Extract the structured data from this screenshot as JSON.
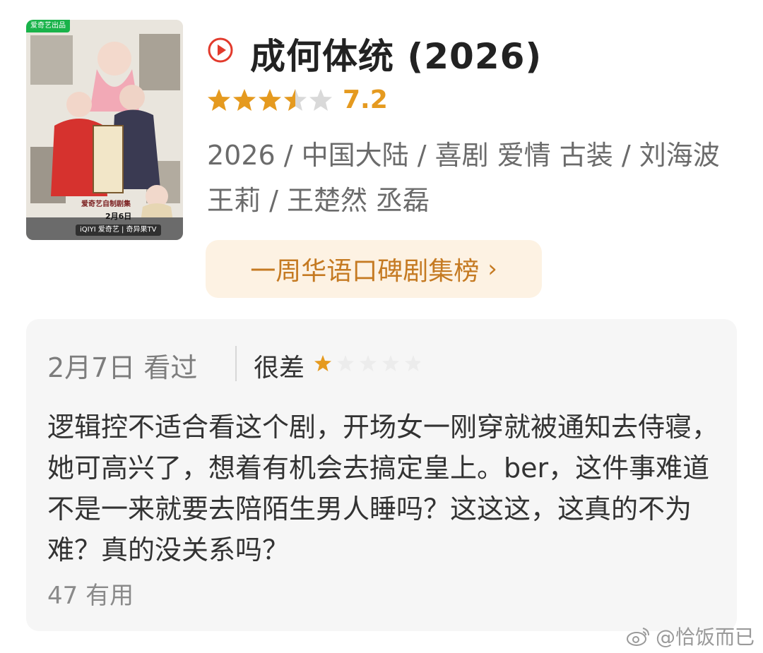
{
  "poster": {
    "brand_tag": "爱奇艺出品",
    "series_tag": "爱奇艺自制剧集",
    "date_tag": "2月6日",
    "platforms": "iQIYI 爱奇艺 | 奇异果TV"
  },
  "movie": {
    "title": "成何体统 (2026)",
    "rating": "7.2",
    "rating_stars_fraction": 0.7,
    "meta": "2026 / 中国大陆 / 喜剧 爱情 古装 / 刘海波 王莉 / 王楚然 丞磊"
  },
  "rank_chip": {
    "label": "一周华语口碑剧集榜",
    "chevron": "›"
  },
  "review": {
    "date": "2月7日 看过",
    "verdict": "很差",
    "stars": 1,
    "text": "逻辑控不适合看这个剧，开场女一刚穿就被通知去侍寝，她可高兴了，想着有机会去搞定皇上。ber，这件事难道不是一来就要去陪陌生男人睡吗？这这这，这真的不为难？真的没关系吗？",
    "useful": "47 有用"
  },
  "watermark": {
    "text": "@恰饭而已"
  },
  "colors": {
    "accent_orange": "#e59a1f",
    "play_red": "#e23a2c",
    "chip_bg": "#fdf2e3",
    "chip_text": "#c57a22",
    "card_bg": "#f6f6f6"
  }
}
